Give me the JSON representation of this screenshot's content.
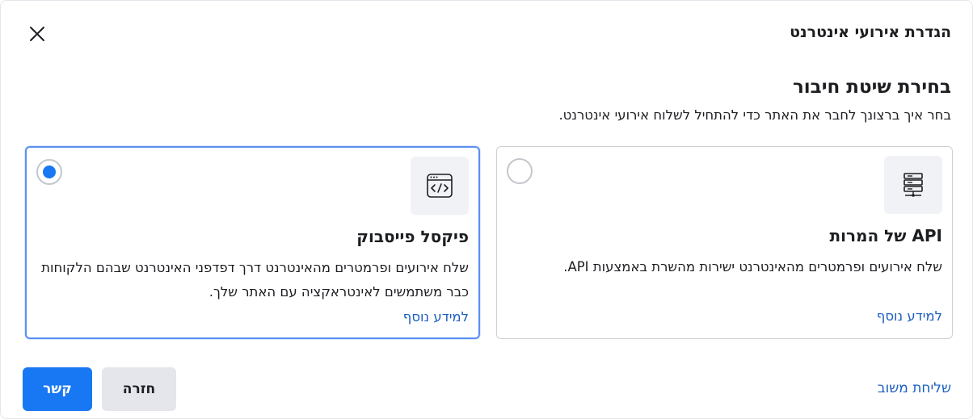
{
  "header": {
    "title": "הגדרת אירועי אינטרנט"
  },
  "section": {
    "title": "בחירת שיטת חיבור",
    "subtitle": "בחר איך ברצונך לחבר את האתר כדי להתחיל לשלוח אירועי אינטרנט."
  },
  "options": [
    {
      "title": "API של המרות",
      "description": "שלח אירועים ופרמטרים מהאינטרנט ישירות מהשרת באמצעות API.",
      "link": "למידע נוסף",
      "icon": "server-icon",
      "selected": false
    },
    {
      "title": "פיקסל פייסבוק",
      "description": "שלח אירועים ופרמטרים מהאינטרנט דרך דפדפני האינטרנט שבהם הלקוחות כבר משתמשים לאינטראקציה עם האתר שלך.",
      "link": "למידע נוסף",
      "icon": "browser-code-icon",
      "selected": true
    }
  ],
  "footer": {
    "feedback_link": "שליחת משוב",
    "back_label": "חזרה",
    "connect_label": "קשר"
  },
  "colors": {
    "primary": "#1877f2",
    "link": "#1b5ec1",
    "selected_border": "#5b8ff2"
  }
}
